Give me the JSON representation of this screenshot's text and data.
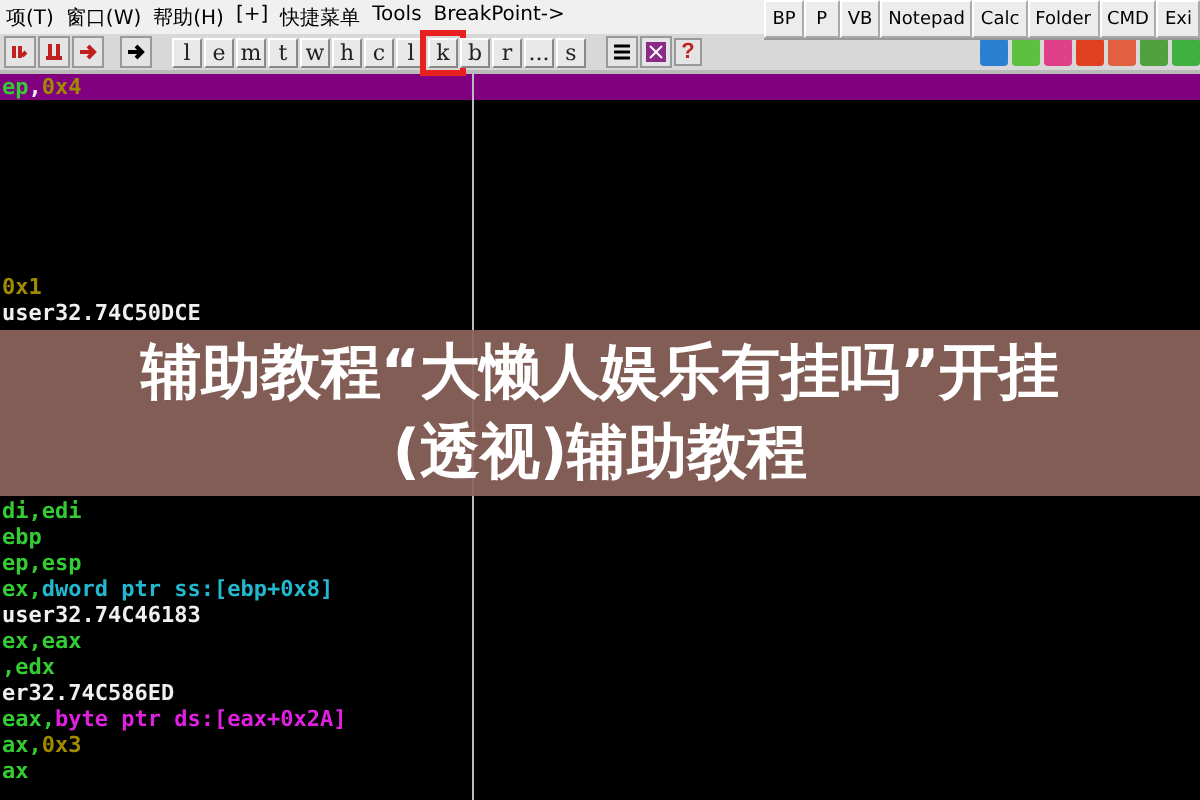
{
  "menu": [
    "项(T)",
    "窗口(W)",
    "帮助(H)",
    "[+]",
    "快捷菜单",
    "Tools",
    "BreakPoint->"
  ],
  "quick_buttons": [
    "BP",
    "P",
    "VB",
    "Notepad",
    "Calc",
    "Folder",
    "CMD",
    "Exi"
  ],
  "toolbar_letters": [
    {
      "label": "l",
      "annotated": false
    },
    {
      "label": "e",
      "annotated": false
    },
    {
      "label": "m",
      "annotated": false
    },
    {
      "label": "t",
      "annotated": false
    },
    {
      "label": "w",
      "annotated": false
    },
    {
      "label": "h",
      "annotated": false
    },
    {
      "label": "c",
      "annotated": false
    },
    {
      "label": "l",
      "annotated": false
    },
    {
      "label": "k",
      "annotated": true
    },
    {
      "label": "b",
      "annotated": false
    },
    {
      "label": "r",
      "annotated": false
    },
    {
      "label": "...",
      "annotated": false
    },
    {
      "label": "s",
      "annotated": false
    }
  ],
  "toolbar_help": "?",
  "code_blocks": [
    {
      "lines": [
        {
          "selected": true,
          "parts": [
            {
              "text": "ep",
              "kind": "reg"
            },
            {
              "text": ",",
              "kind": "plain"
            },
            {
              "text": "0x4",
              "kind": "const"
            }
          ]
        }
      ]
    },
    {
      "lines": [
        {
          "selected": false,
          "parts": [
            {
              "text": "0x1",
              "kind": "const"
            }
          ]
        },
        {
          "selected": false,
          "parts": [
            {
              "text": "user32.74C50DCE",
              "kind": "plain"
            }
          ]
        }
      ]
    },
    {
      "lines": [
        {
          "selected": false,
          "parts": [
            {
              "text": "di,edi",
              "kind": "reg"
            }
          ]
        },
        {
          "selected": false,
          "parts": [
            {
              "text": "ebp",
              "kind": "reg"
            }
          ]
        },
        {
          "selected": false,
          "parts": [
            {
              "text": "ep,esp",
              "kind": "reg"
            }
          ]
        },
        {
          "selected": false,
          "parts": [
            {
              "text": "ex,",
              "kind": "reg"
            },
            {
              "text": "dword ptr ss:[ebp+0x8]",
              "kind": "mem"
            }
          ]
        },
        {
          "selected": false,
          "parts": [
            {
              "text": "user32.74C46183",
              "kind": "plain"
            }
          ]
        },
        {
          "selected": false,
          "parts": [
            {
              "text": "ex,eax",
              "kind": "reg"
            }
          ]
        },
        {
          "selected": false,
          "parts": [
            {
              "text": ",edx",
              "kind": "reg"
            }
          ]
        },
        {
          "selected": false,
          "parts": [
            {
              "text": "er32.74C586ED",
              "kind": "plain"
            }
          ]
        },
        {
          "selected": false,
          "parts": [
            {
              "text": "eax,",
              "kind": "reg"
            },
            {
              "text": "byte ptr ds:[eax+0x2A]",
              "kind": "byte"
            }
          ]
        },
        {
          "selected": false,
          "parts": [
            {
              "text": "ax,",
              "kind": "reg"
            },
            {
              "text": "0x3",
              "kind": "const"
            }
          ]
        },
        {
          "selected": false,
          "parts": [
            {
              "text": "ax",
              "kind": "reg"
            }
          ]
        }
      ]
    }
  ],
  "banner": {
    "title": "辅助教程“大懒人娱乐有挂吗”开挂(透视)辅助教程"
  }
}
